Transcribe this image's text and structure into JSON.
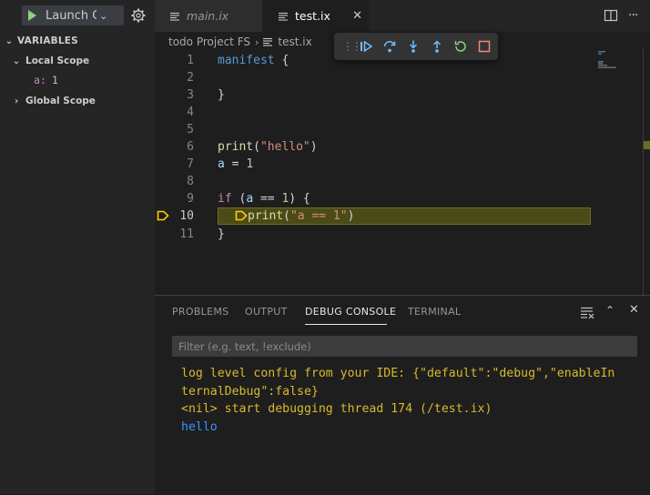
{
  "sidebar": {
    "launch_label": "Launch Cu",
    "variables_header": "VARIABLES",
    "local_scope": "Local Scope",
    "variable": {
      "name": "a",
      "value": "1"
    },
    "global_scope": "Global Scope"
  },
  "tabs": [
    {
      "label": "main.ix",
      "active": false
    },
    {
      "label": "test.ix",
      "active": true
    }
  ],
  "breadcrumb": {
    "folder": "todo Project FS",
    "file": "test.ix"
  },
  "editor": {
    "current_line": 10,
    "lines": [
      {
        "n": "1"
      },
      {
        "n": "2"
      },
      {
        "n": "3"
      },
      {
        "n": "4"
      },
      {
        "n": "5"
      },
      {
        "n": "6"
      },
      {
        "n": "7"
      },
      {
        "n": "8"
      },
      {
        "n": "9"
      },
      {
        "n": "10"
      },
      {
        "n": "11"
      }
    ],
    "tokens": {
      "l1_kw": "manifest",
      "l1_rest": " {",
      "l3": "}",
      "l6_fn": "print",
      "l6_p1": "(",
      "l6_str": "\"hello\"",
      "l6_p2": ")",
      "l7_var": "a",
      "l7_op": " = ",
      "l7_num": "1",
      "l9_kw": "if",
      "l9_p1": " (",
      "l9_var": "a",
      "l9_op": " == ",
      "l9_num": "1",
      "l9_p2": ") {",
      "l10_fn": "print",
      "l10_p1": "(",
      "l10_str": "\"a == 1\"",
      "l10_p2": ")",
      "l11": "}"
    }
  },
  "panel": {
    "tabs": [
      "PROBLEMS",
      "OUTPUT",
      "DEBUG CONSOLE",
      "TERMINAL"
    ],
    "active_tab": "DEBUG CONSOLE",
    "filter_placeholder": "Filter (e.g. text, !exclude)",
    "console_lines": [
      {
        "text": "log level config from your IDE: {\"default\":\"debug\",\"enableIn",
        "color": "#d7ba2d"
      },
      {
        "text": "ternalDebug\":false}",
        "color": "#d7ba2d"
      },
      {
        "text": "<nil> start debugging thread 174 (/test.ix)",
        "color": "#d7ba2d"
      },
      {
        "text": "hello",
        "color": "#3794ff"
      }
    ]
  },
  "colors": {
    "accent": "#007acc",
    "current_line": "#4b4b18",
    "breakpoint_arrow": "#ffcc00",
    "debug_blue": "#75beff",
    "debug_green": "#89d185",
    "debug_red": "#f48771"
  }
}
